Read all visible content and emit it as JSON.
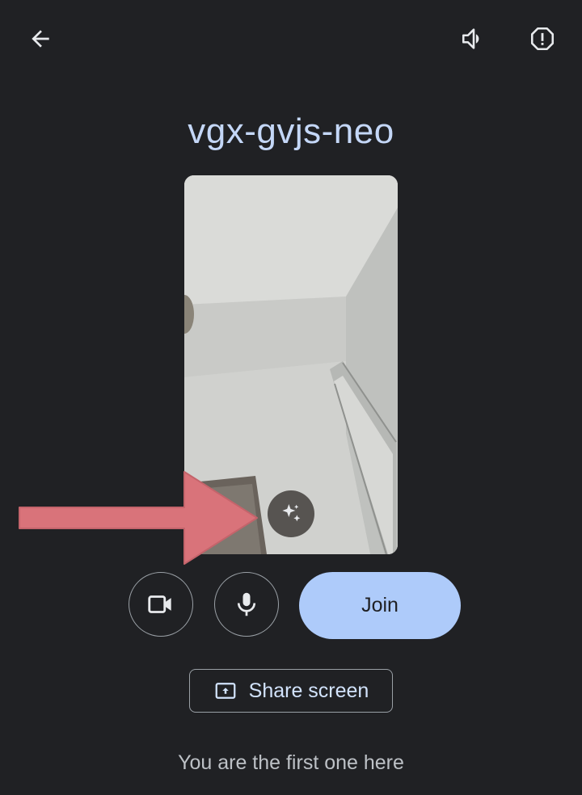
{
  "meeting": {
    "code": "vgx-gvjs-neo",
    "status_text": "You are the first one here"
  },
  "topbar": {
    "back_icon": "arrow-back-icon",
    "speaker_icon": "speaker-icon",
    "report_icon": "report-icon"
  },
  "controls": {
    "camera_icon": "videocam-icon",
    "mic_icon": "mic-icon",
    "join_label": "Join",
    "share_label": "Share screen",
    "share_icon": "present-to-all-icon",
    "effects_icon": "sparkle-icon"
  },
  "colors": {
    "background": "#202124",
    "meeting_code": "#c4d7f7",
    "join_button": "#aecbfa",
    "annotation_arrow": "#d9737a"
  }
}
